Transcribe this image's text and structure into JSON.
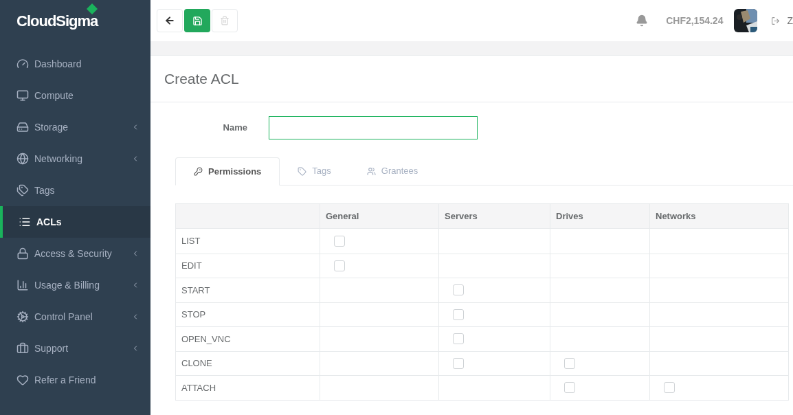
{
  "sidebar": {
    "logo": "CloudSigma",
    "items": [
      {
        "label": "Dashboard",
        "submenu": false,
        "selected": false
      },
      {
        "label": "Compute",
        "submenu": false,
        "selected": false
      },
      {
        "label": "Storage",
        "submenu": true,
        "selected": false
      },
      {
        "label": "Networking",
        "submenu": true,
        "selected": false
      },
      {
        "label": "Tags",
        "submenu": false,
        "selected": false
      },
      {
        "label": "ACLs",
        "submenu": false,
        "selected": true
      },
      {
        "label": "Access & Security",
        "submenu": true,
        "selected": false
      },
      {
        "label": "Usage & Billing",
        "submenu": true,
        "selected": false
      },
      {
        "label": "Control Panel",
        "submenu": true,
        "selected": false
      },
      {
        "label": "Support",
        "submenu": true,
        "selected": false
      },
      {
        "label": "Refer a Friend",
        "submenu": false,
        "selected": false
      }
    ]
  },
  "toolbar": {
    "delete_disabled": true
  },
  "header": {
    "balance": "CHF2,154.24",
    "user": "Z"
  },
  "page": {
    "title": "Create ACL",
    "name_label": "Name"
  },
  "tabs": [
    {
      "label": "Permissions",
      "selected": true
    },
    {
      "label": "Tags",
      "selected": false
    },
    {
      "label": "Grantees",
      "selected": false
    }
  ],
  "table": {
    "columns": [
      "",
      "General",
      "Servers",
      "Drives",
      "Networks"
    ],
    "rows": [
      {
        "label": "LIST",
        "cells": [
          {
            "kind": "checkbox",
            "checked": false
          },
          {
            "kind": "empty"
          },
          {
            "kind": "empty"
          },
          {
            "kind": "empty"
          }
        ]
      },
      {
        "label": "EDIT",
        "cells": [
          {
            "kind": "checkbox",
            "checked": false
          },
          {
            "kind": "empty"
          },
          {
            "kind": "empty"
          },
          {
            "kind": "empty"
          }
        ]
      },
      {
        "label": "START",
        "cells": [
          {
            "kind": "empty"
          },
          {
            "kind": "checkbox",
            "checked": false
          },
          {
            "kind": "empty"
          },
          {
            "kind": "empty"
          }
        ]
      },
      {
        "label": "STOP",
        "cells": [
          {
            "kind": "empty"
          },
          {
            "kind": "checkbox",
            "checked": false
          },
          {
            "kind": "empty"
          },
          {
            "kind": "empty"
          }
        ]
      },
      {
        "label": "OPEN_VNC",
        "cells": [
          {
            "kind": "empty"
          },
          {
            "kind": "checkbox",
            "checked": false
          },
          {
            "kind": "empty"
          },
          {
            "kind": "empty"
          }
        ]
      },
      {
        "label": "CLONE",
        "cells": [
          {
            "kind": "empty"
          },
          {
            "kind": "checkbox",
            "checked": false
          },
          {
            "kind": "checkbox",
            "checked": false
          },
          {
            "kind": "empty"
          }
        ]
      },
      {
        "label": "ATTACH",
        "cells": [
          {
            "kind": "empty"
          },
          {
            "kind": "empty"
          },
          {
            "kind": "checkbox",
            "checked": false
          },
          {
            "kind": "checkbox",
            "checked": false
          }
        ]
      }
    ]
  }
}
